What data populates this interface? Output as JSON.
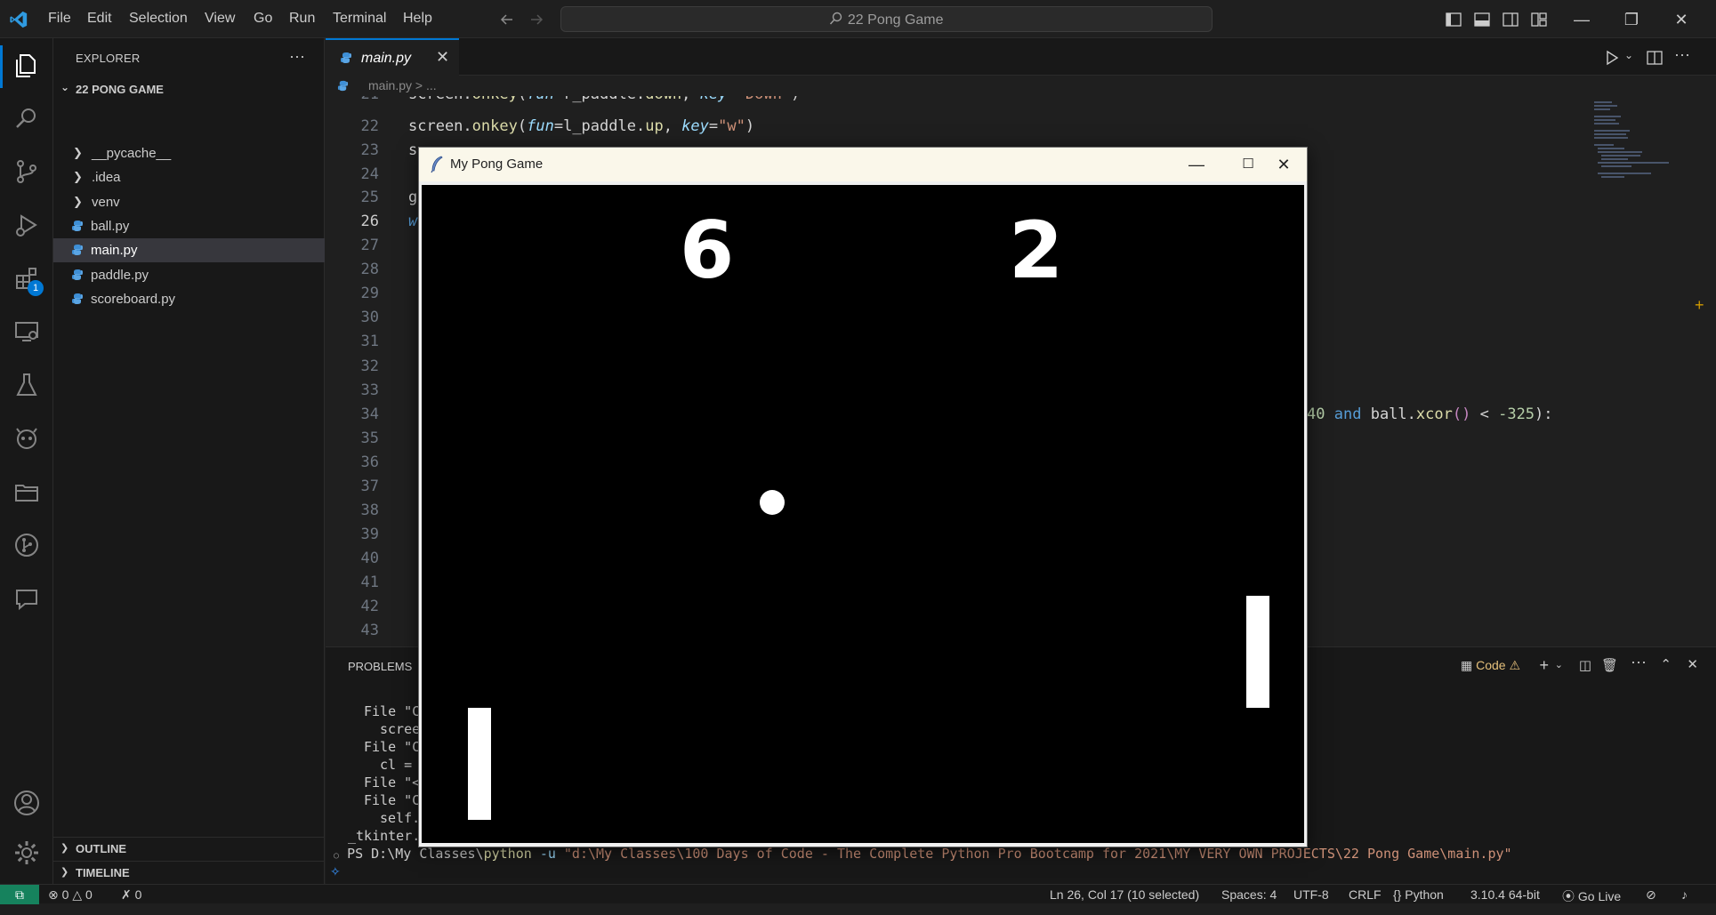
{
  "titlebar": {
    "menu": [
      "File",
      "Edit",
      "Selection",
      "View",
      "Go",
      "Run",
      "Terminal",
      "Help"
    ],
    "search": "22 Pong Game"
  },
  "sidebar": {
    "title": "EXPLORER",
    "folder": "22 PONG GAME",
    "items": [
      {
        "label": "__pycache__",
        "kind": "folder"
      },
      {
        "label": ".idea",
        "kind": "folder"
      },
      {
        "label": "venv",
        "kind": "folder"
      },
      {
        "label": "ball.py",
        "kind": "python"
      },
      {
        "label": "main.py",
        "kind": "python"
      },
      {
        "label": "paddle.py",
        "kind": "python"
      },
      {
        "label": "scoreboard.py",
        "kind": "python"
      }
    ],
    "outline": "OUTLINE",
    "timeline": "TIMELINE",
    "extensions_badge": "1"
  },
  "editor": {
    "tab": "main.py",
    "breadcrumb": "main.py > ...",
    "line_numbers": [
      "21",
      "22",
      "23",
      "24",
      "25",
      "26",
      "27",
      "28",
      "29",
      "30",
      "31",
      "32",
      "33",
      "34",
      "35",
      "36",
      "37",
      "38",
      "39",
      "40",
      "41",
      "42",
      "43"
    ],
    "line21": {
      "obj": "screen",
      "method": "onkey",
      "p1": "fun",
      "v1": "r_paddle",
      "m1": "down",
      "p2": "key",
      "v2": "\"Down\""
    },
    "line22": {
      "obj": "screen",
      "method": "onkey",
      "p1": "fun",
      "v1": "l_paddle",
      "m1": "up",
      "p2": "key",
      "v2": "\"w\""
    },
    "line23_prefix": "s",
    "line25_prefix": "g",
    "line26_prefix": "w",
    "line34_tail": {
      "num1": "40",
      "kw": "and",
      "obj": "ball",
      "method": "xcor",
      "op": "<",
      "num2": "-325"
    }
  },
  "panel": {
    "title": "PROBLEMS",
    "terminal_label": "Code",
    "term_lines": [
      "File \"C",
      "scree",
      "File \"C",
      "cl =",
      "File \"<",
      "File \"C",
      "self.",
      "_tkinter."
    ],
    "prompt": "PS D:\\My Classes\\",
    "command": "python",
    "flag": "-u",
    "path": "\"d:\\My Classes\\100 Days of Code - The Complete Python Pro Bootcamp for 2021\\MY VERY OWN PROJECTS\\22 Pong Game\\main.py\""
  },
  "statusbar": {
    "errors": "0",
    "warnings": "0",
    "ports": "0",
    "cursor": "Ln 26, Col 17 (10 selected)",
    "spaces": "Spaces: 4",
    "encoding": "UTF-8",
    "eol": "CRLF",
    "language": "Python",
    "interpreter": "3.10.4 64-bit",
    "golive": "Go Live"
  },
  "pong": {
    "title": "My Pong Game",
    "left_score": "6",
    "right_score": "2"
  }
}
